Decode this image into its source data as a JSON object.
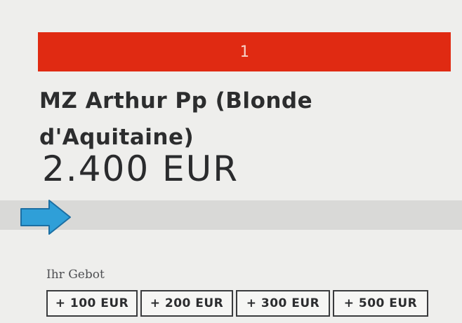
{
  "lot": {
    "number": "1"
  },
  "title": "MZ Arthur Pp (Blonde d'Aquitaine)",
  "price": "2.400 EUR",
  "progress": {
    "fraction": 0.0
  },
  "bid": {
    "label": "Ihr Gebot",
    "options": [
      "+ 100 EUR",
      "+ 200 EUR",
      "+ 300 EUR",
      "+ 500 EUR"
    ]
  },
  "colors": {
    "banner": "#e02a12",
    "arrow": "#2f9fd8"
  },
  "icons": {
    "pointer": "arrow-right-icon"
  }
}
